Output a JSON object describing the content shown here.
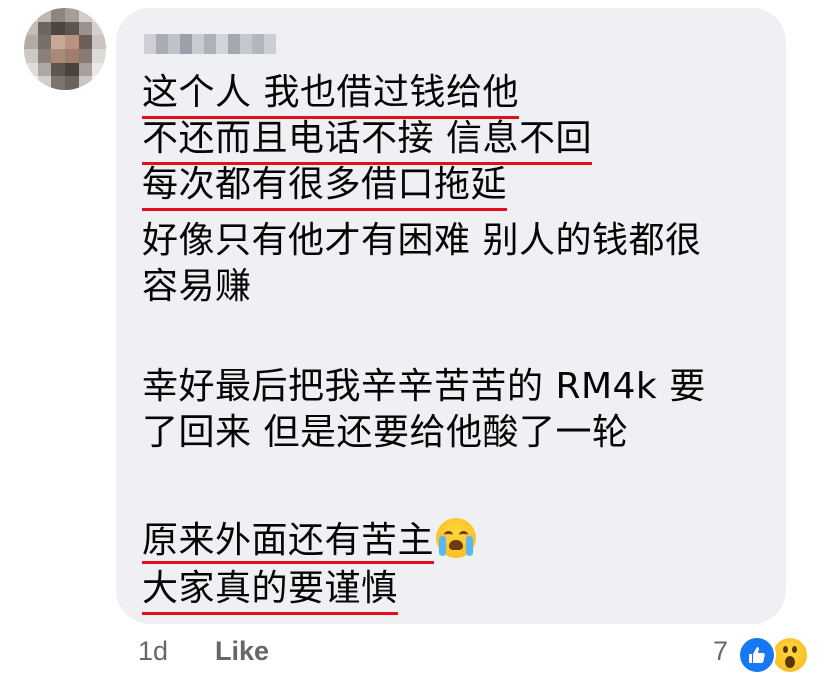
{
  "comment": {
    "author_name": "██████",
    "lines": [
      "这个人 我也借过钱给他",
      "不还而且电话不接 信息不回",
      "每次都有很多借口拖延",
      "好像只有他才有困难 别人的钱都很",
      "容易赚",
      "幸好最后把我辛辛苦苦的 RM4k 要",
      "了回来 但是还要给他酸了一轮",
      "原来外面还有苦主",
      "大家真的要谨慎"
    ],
    "emoji_icon": "loudly-crying-face"
  },
  "footer": {
    "timestamp": "1d",
    "like_label": "Like",
    "reaction_count": "7",
    "reactions": [
      "like-icon",
      "wow-icon"
    ]
  },
  "colors": {
    "bubble_bg": "#eff0f4",
    "underline": "#e3101c",
    "like_blue": "#1877f2",
    "meta_gray": "#65676b"
  }
}
